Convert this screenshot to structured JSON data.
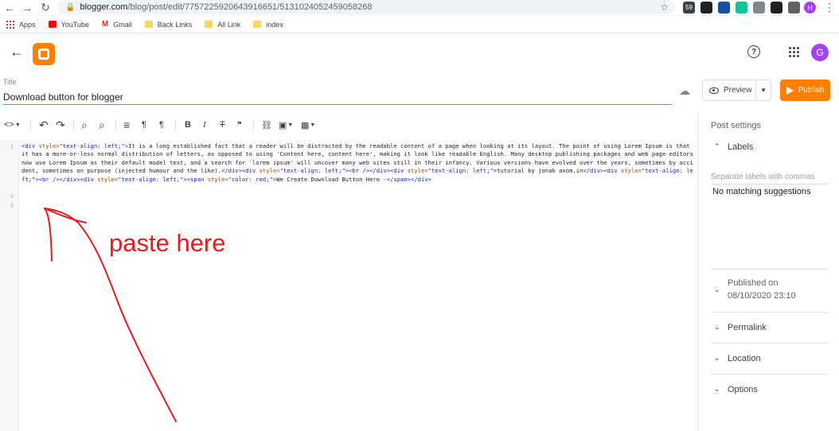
{
  "browser": {
    "url_host": "blogger.com",
    "url_path": "/blog/post/edit/7757225920643916651/5131024052459058268",
    "profile_initial": "H",
    "extensions": [
      {
        "icon": "ext-1-icon",
        "text": "59",
        "color": "#3c4043"
      },
      {
        "icon": "ext-2-icon",
        "text": "",
        "color": "#202124"
      },
      {
        "icon": "ext-3-icon",
        "text": "",
        "color": "#174ea6"
      },
      {
        "icon": "grammarly-icon",
        "text": "",
        "color": "#15c39a"
      },
      {
        "icon": "ext-5-icon",
        "text": "",
        "color": "#80868b"
      },
      {
        "icon": "ext-6-icon",
        "text": "",
        "color": "#202124"
      },
      {
        "icon": "puzzle-icon",
        "text": "",
        "color": "#5f6368"
      }
    ]
  },
  "bookmarks": [
    {
      "label": "Apps",
      "icon": "apps-icon"
    },
    {
      "label": "YouTube",
      "icon": "youtube-icon"
    },
    {
      "label": "Gmail",
      "icon": "gmail-icon"
    },
    {
      "label": "Back Links",
      "icon": "folder-icon"
    },
    {
      "label": "All Link",
      "icon": "folder-icon"
    },
    {
      "label": "index",
      "icon": "folder-icon"
    }
  ],
  "header": {
    "avatar_initial": "G",
    "help_glyph": "?"
  },
  "post": {
    "title_label": "Title",
    "title_value": "Download button for blogger"
  },
  "actions": {
    "preview_label": "Preview",
    "publish_label": "Publish"
  },
  "toolbar": {
    "view_glyph": "<>",
    "undo_glyph": "↶",
    "redo_glyph": "↷",
    "search_glyph": "⌕",
    "replace_glyph": "⌕",
    "align_glyph": "≡",
    "para_glyph": "¶",
    "para_rtl_glyph": "¶",
    "bold_glyph": "B",
    "italic_glyph": "I",
    "strike_glyph": "T",
    "quote_glyph": "❞",
    "link_glyph": "⛓",
    "image_glyph": "▣",
    "video_glyph": "▦"
  },
  "editor": {
    "line_numbers": [
      "1",
      "2",
      "3"
    ],
    "code": [
      {
        "t": "tag",
        "v": "<div "
      },
      {
        "t": "attr",
        "v": "style="
      },
      {
        "t": "str",
        "v": "\"text-align: left;\""
      },
      {
        "t": "tag",
        "v": ">"
      },
      {
        "t": "text",
        "v": "It is a long established fact that a reader will be distracted by the readable content of a page when looking at its layout. The point of using Lorem Ipsum is that it has a more-or-less normal distribution of letters, as opposed to using 'Content here, content here', making it look like readable English. Many desktop publishing packages and web page editors now use Lorem Ipsum as their default model text, and a search for 'lorem ipsum' will uncover many web sites still in their infancy. Various versions have evolved over the years, sometimes by accident, sometimes on purpose (injected humour and the like)."
      },
      {
        "t": "tag",
        "v": "</div><div "
      },
      {
        "t": "attr",
        "v": "style="
      },
      {
        "t": "str",
        "v": "\"text-align: left;\""
      },
      {
        "t": "tag",
        "v": "><br />"
      },
      {
        "t": "tag",
        "v": "</div><div "
      },
      {
        "t": "attr",
        "v": "style="
      },
      {
        "t": "str",
        "v": "\"text-align: left;\""
      },
      {
        "t": "tag",
        "v": ">"
      },
      {
        "t": "text",
        "v": "tutorial by jonak axom.in"
      },
      {
        "t": "tag",
        "v": "</div><div "
      },
      {
        "t": "attr",
        "v": "style="
      },
      {
        "t": "str",
        "v": "\"text-align: left;\""
      },
      {
        "t": "tag",
        "v": "><br /></div><div "
      },
      {
        "t": "attr",
        "v": "style="
      },
      {
        "t": "str",
        "v": "\"text-align: left;\""
      },
      {
        "t": "tag",
        "v": "><span "
      },
      {
        "t": "attr",
        "v": "style="
      },
      {
        "t": "str",
        "v": "\"color: red;\""
      },
      {
        "t": "tag",
        "v": ">"
      },
      {
        "t": "text",
        "v": "We Create Download Button Here -"
      },
      {
        "t": "tag",
        "v": "</span></div>"
      }
    ]
  },
  "annotation": {
    "text": "paste here",
    "color": "#e21b1b"
  },
  "sidebar": {
    "title": "Post settings",
    "labels": {
      "heading": "Labels",
      "placeholder": "Separate labels with commas",
      "no_match": "No matching suggestions"
    },
    "published": {
      "heading": "Published on",
      "date": "08/10/2020 23:10"
    },
    "sections": [
      "Permalink",
      "Location",
      "Options"
    ]
  },
  "colors": {
    "accent": "#ff8000",
    "annotation": "#e21b1b"
  }
}
